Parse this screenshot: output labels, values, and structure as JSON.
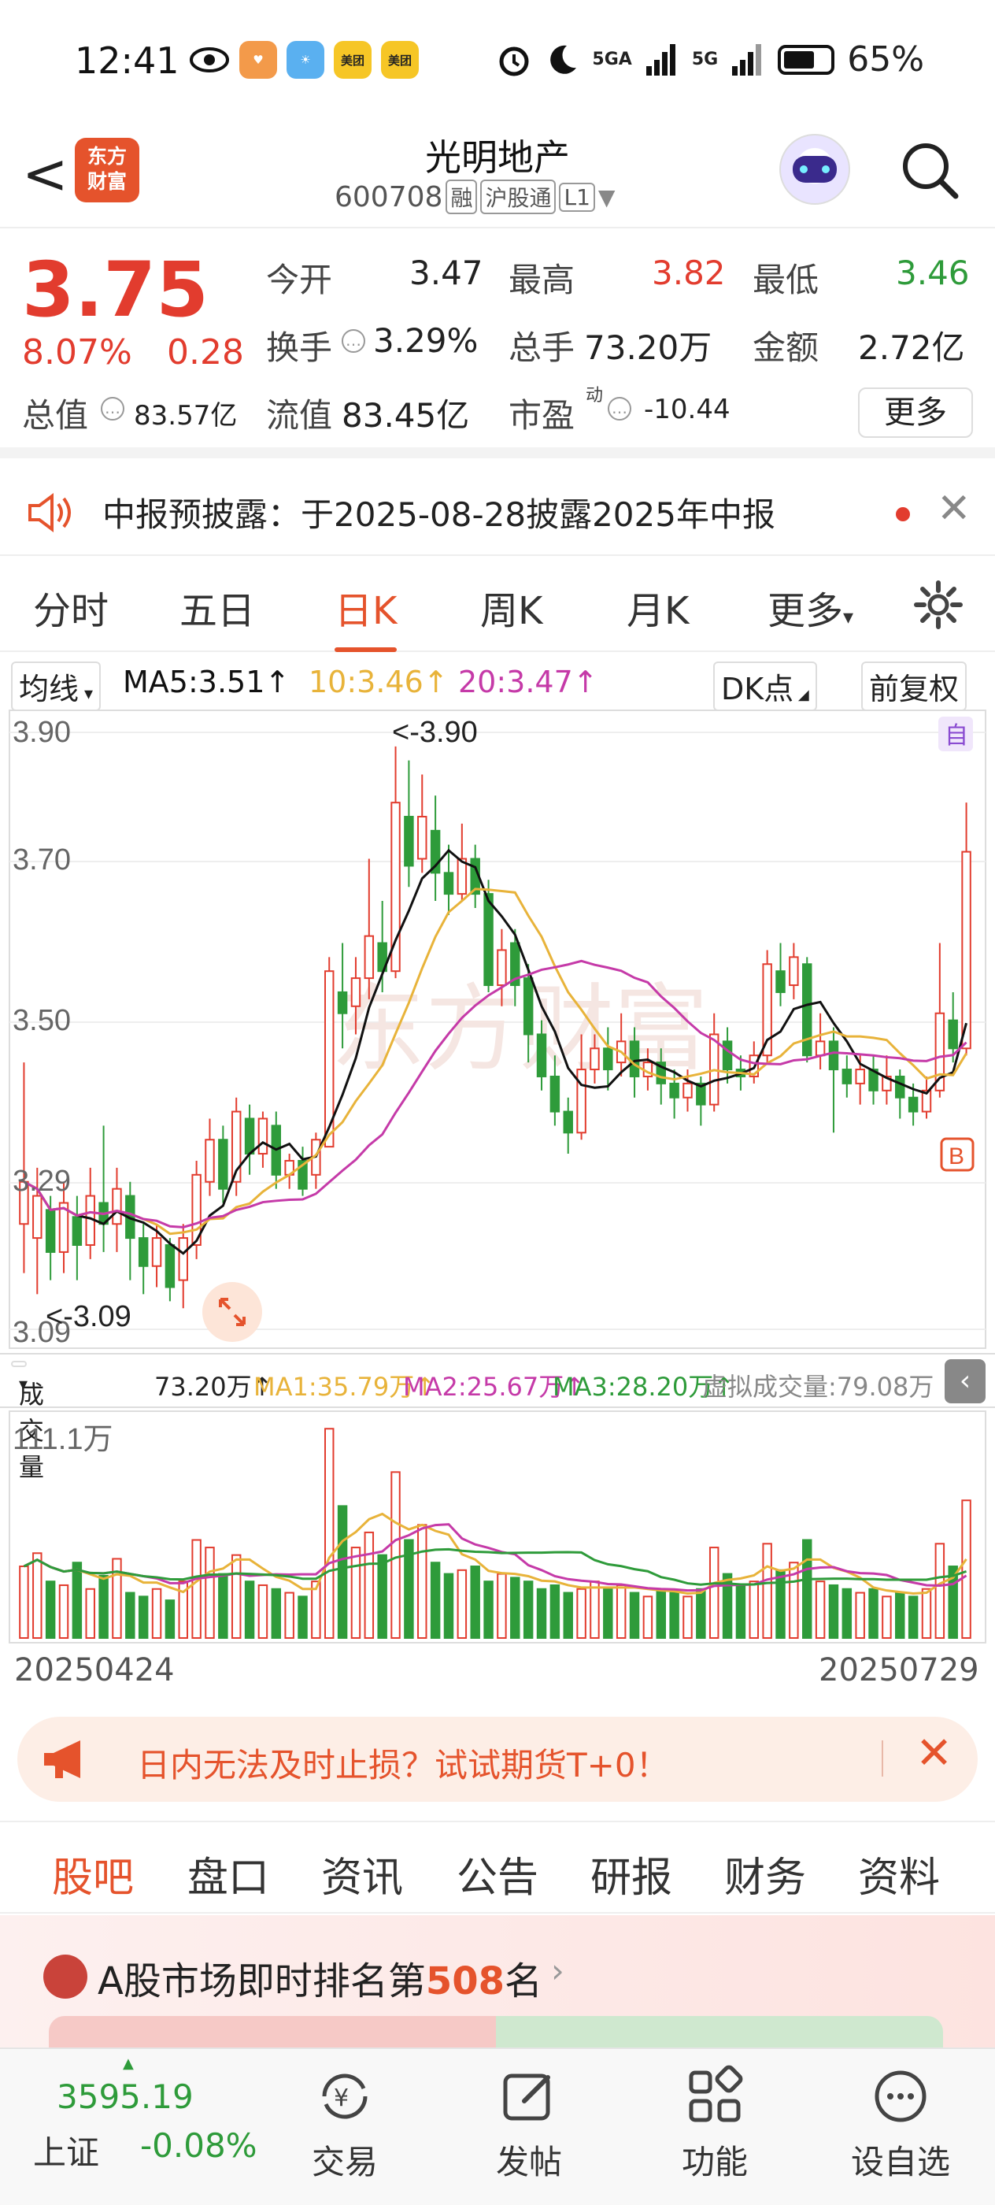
{
  "status": {
    "time": "12:41",
    "battery": "65%",
    "net1": "5GA",
    "net2": "5G"
  },
  "header": {
    "back": "<",
    "logo_line1": "东方",
    "logo_line2": "财富",
    "name": "光明地产",
    "code": "600708",
    "tag1": "融",
    "tag2": "沪股通",
    "tag3": "L1"
  },
  "quote": {
    "price": "3.75",
    "change_pct": "8.07%",
    "change": "0.28",
    "open_label": "今开",
    "open": "3.47",
    "high_label": "最高",
    "high": "3.82",
    "low_label": "最低",
    "low": "3.46",
    "turnover_label": "换手",
    "turnover": "3.29%",
    "volume_label": "总手",
    "volume": "73.20万",
    "amount_label": "金额",
    "amount": "2.72亿",
    "mktcap_label": "总值",
    "mktcap": "83.57亿",
    "float_label": "流值",
    "float": "83.45亿",
    "pe_label": "市盈",
    "pe_sup": "动",
    "pe": "-10.44",
    "more": "更多"
  },
  "notice": {
    "text": "中报预披露：于2025-08-28披露2025年中报",
    "close": "✕"
  },
  "chart_tabs": [
    "分时",
    "五日",
    "日K",
    "周K",
    "月K",
    "更多"
  ],
  "ma": {
    "selector": "均线",
    "ma5": "MA5:3.51↑",
    "ma10": "10:3.46↑",
    "ma20": "20:3.47↑",
    "dk": "DK点",
    "adjust": "前复权"
  },
  "kchart_labels": {
    "y1": "3.90",
    "y2": "3.70",
    "y3": "3.50",
    "y4": "3.29",
    "y5": "3.09",
    "high_note": "<-3.90",
    "low_note": "<-3.09",
    "auto": "自",
    "buy": "B",
    "watermark": "东方财富"
  },
  "volume_bar": {
    "selector": "成交量",
    "vol": "73.20万↑",
    "ma1": "MA1:35.79万↑",
    "ma2": "MA2:25.67万↑",
    "ma3": "MA3:28.20万↑",
    "virtual": "虚拟成交量:79.08万",
    "max": "111.1万"
  },
  "dates": {
    "start": "20250424",
    "end": "20250729"
  },
  "ad": {
    "text": "日内无法及时止损？试试期货T+0！",
    "close": "✕"
  },
  "section_tabs": [
    "股吧",
    "盘口",
    "资讯",
    "公告",
    "研报",
    "财务",
    "资料"
  ],
  "rank": {
    "prefix": "A股市场即时排名第",
    "number": "508",
    "suffix": "名",
    "arrow": "›"
  },
  "bottom": {
    "index_value": "3595.19",
    "index_name": "上证",
    "index_change": "-0.08%",
    "items": [
      "交易",
      "发帖",
      "功能",
      "设自选"
    ]
  },
  "colors": {
    "up": "#e23c2e",
    "down": "#2e9b3a",
    "accent": "#e5532c",
    "ma5": "#111111",
    "ma10": "#e8b33a",
    "ma20": "#c53aa8"
  },
  "chart_data": {
    "type": "candlestick",
    "ylim": [
      3.07,
      3.92
    ],
    "y_ticks": [
      3.9,
      3.7,
      3.5,
      3.29,
      3.09
    ],
    "x_start": "20250424",
    "x_end": "20250729",
    "ohlc": [
      [
        3.22,
        3.28,
        3.15,
        3.45
      ],
      [
        3.2,
        3.26,
        3.12,
        3.3
      ],
      [
        3.24,
        3.18,
        3.14,
        3.26
      ],
      [
        3.18,
        3.25,
        3.15,
        3.28
      ],
      [
        3.23,
        3.19,
        3.14,
        3.26
      ],
      [
        3.19,
        3.26,
        3.17,
        3.3
      ],
      [
        3.25,
        3.22,
        3.18,
        3.36
      ],
      [
        3.22,
        3.27,
        3.18,
        3.3
      ],
      [
        3.26,
        3.2,
        3.14,
        3.28
      ],
      [
        3.2,
        3.16,
        3.12,
        3.22
      ],
      [
        3.16,
        3.2,
        3.13,
        3.22
      ],
      [
        3.19,
        3.13,
        3.11,
        3.2
      ],
      [
        3.14,
        3.2,
        3.1,
        3.22
      ],
      [
        3.19,
        3.29,
        3.17,
        3.31
      ],
      [
        3.28,
        3.34,
        3.26,
        3.37
      ],
      [
        3.34,
        3.27,
        3.25,
        3.36
      ],
      [
        3.28,
        3.38,
        3.26,
        3.4
      ],
      [
        3.37,
        3.32,
        3.29,
        3.39
      ],
      [
        3.32,
        3.37,
        3.3,
        3.38
      ],
      [
        3.36,
        3.29,
        3.27,
        3.38
      ],
      [
        3.29,
        3.31,
        3.27,
        3.32
      ],
      [
        3.31,
        3.27,
        3.26,
        3.33
      ],
      [
        3.29,
        3.34,
        3.27,
        3.35
      ],
      [
        3.33,
        3.58,
        3.33,
        3.6
      ],
      [
        3.55,
        3.52,
        3.47,
        3.62
      ],
      [
        3.53,
        3.57,
        3.49,
        3.6
      ],
      [
        3.57,
        3.63,
        3.54,
        3.74
      ],
      [
        3.62,
        3.58,
        3.55,
        3.68
      ],
      [
        3.58,
        3.82,
        3.57,
        3.9
      ],
      [
        3.8,
        3.73,
        3.7,
        3.88
      ],
      [
        3.74,
        3.8,
        3.72,
        3.86
      ],
      [
        3.78,
        3.72,
        3.68,
        3.83
      ],
      [
        3.72,
        3.69,
        3.66,
        3.76
      ],
      [
        3.69,
        3.74,
        3.68,
        3.79
      ],
      [
        3.74,
        3.69,
        3.67,
        3.76
      ],
      [
        3.69,
        3.56,
        3.55,
        3.71
      ],
      [
        3.56,
        3.61,
        3.53,
        3.64
      ],
      [
        3.62,
        3.56,
        3.53,
        3.64
      ],
      [
        3.57,
        3.49,
        3.45,
        3.59
      ],
      [
        3.49,
        3.43,
        3.41,
        3.51
      ],
      [
        3.43,
        3.38,
        3.36,
        3.46
      ],
      [
        3.38,
        3.35,
        3.32,
        3.4
      ],
      [
        3.35,
        3.44,
        3.34,
        3.49
      ],
      [
        3.44,
        3.47,
        3.42,
        3.49
      ],
      [
        3.47,
        3.44,
        3.41,
        3.5
      ],
      [
        3.45,
        3.48,
        3.43,
        3.52
      ],
      [
        3.48,
        3.43,
        3.4,
        3.5
      ],
      [
        3.43,
        3.45,
        3.41,
        3.47
      ],
      [
        3.45,
        3.42,
        3.39,
        3.47
      ],
      [
        3.42,
        3.4,
        3.37,
        3.44
      ],
      [
        3.4,
        3.42,
        3.38,
        3.44
      ],
      [
        3.42,
        3.39,
        3.36,
        3.43
      ],
      [
        3.39,
        3.49,
        3.38,
        3.52
      ],
      [
        3.48,
        3.44,
        3.42,
        3.5
      ],
      [
        3.44,
        3.43,
        3.41,
        3.46
      ],
      [
        3.43,
        3.46,
        3.42,
        3.48
      ],
      [
        3.46,
        3.59,
        3.45,
        3.61
      ],
      [
        3.58,
        3.55,
        3.53,
        3.62
      ],
      [
        3.56,
        3.6,
        3.54,
        3.62
      ],
      [
        3.59,
        3.46,
        3.45,
        3.6
      ],
      [
        3.46,
        3.48,
        3.44,
        3.52
      ],
      [
        3.48,
        3.44,
        3.35,
        3.5
      ],
      [
        3.44,
        3.42,
        3.4,
        3.46
      ],
      [
        3.42,
        3.44,
        3.39,
        3.46
      ],
      [
        3.44,
        3.41,
        3.39,
        3.46
      ],
      [
        3.41,
        3.43,
        3.39,
        3.46
      ],
      [
        3.43,
        3.4,
        3.37,
        3.44
      ],
      [
        3.4,
        3.38,
        3.36,
        3.42
      ],
      [
        3.38,
        3.41,
        3.37,
        3.43
      ],
      [
        3.41,
        3.52,
        3.4,
        3.62
      ],
      [
        3.51,
        3.47,
        3.45,
        3.55
      ],
      [
        3.47,
        3.75,
        3.46,
        3.82
      ]
    ],
    "volume": [
      38,
      45,
      30,
      28,
      40,
      26,
      33,
      42,
      24,
      22,
      26,
      20,
      30,
      52,
      48,
      34,
      44,
      30,
      28,
      26,
      24,
      22,
      30,
      111,
      70,
      48,
      56,
      44,
      88,
      52,
      60,
      40,
      34,
      36,
      38,
      30,
      34,
      32,
      30,
      26,
      28,
      24,
      26,
      30,
      26,
      28,
      24,
      22,
      26,
      24,
      22,
      26,
      48,
      34,
      28,
      30,
      50,
      36,
      40,
      52,
      30,
      28,
      26,
      24,
      26,
      22,
      24,
      22,
      26,
      50,
      38,
      73
    ]
  }
}
